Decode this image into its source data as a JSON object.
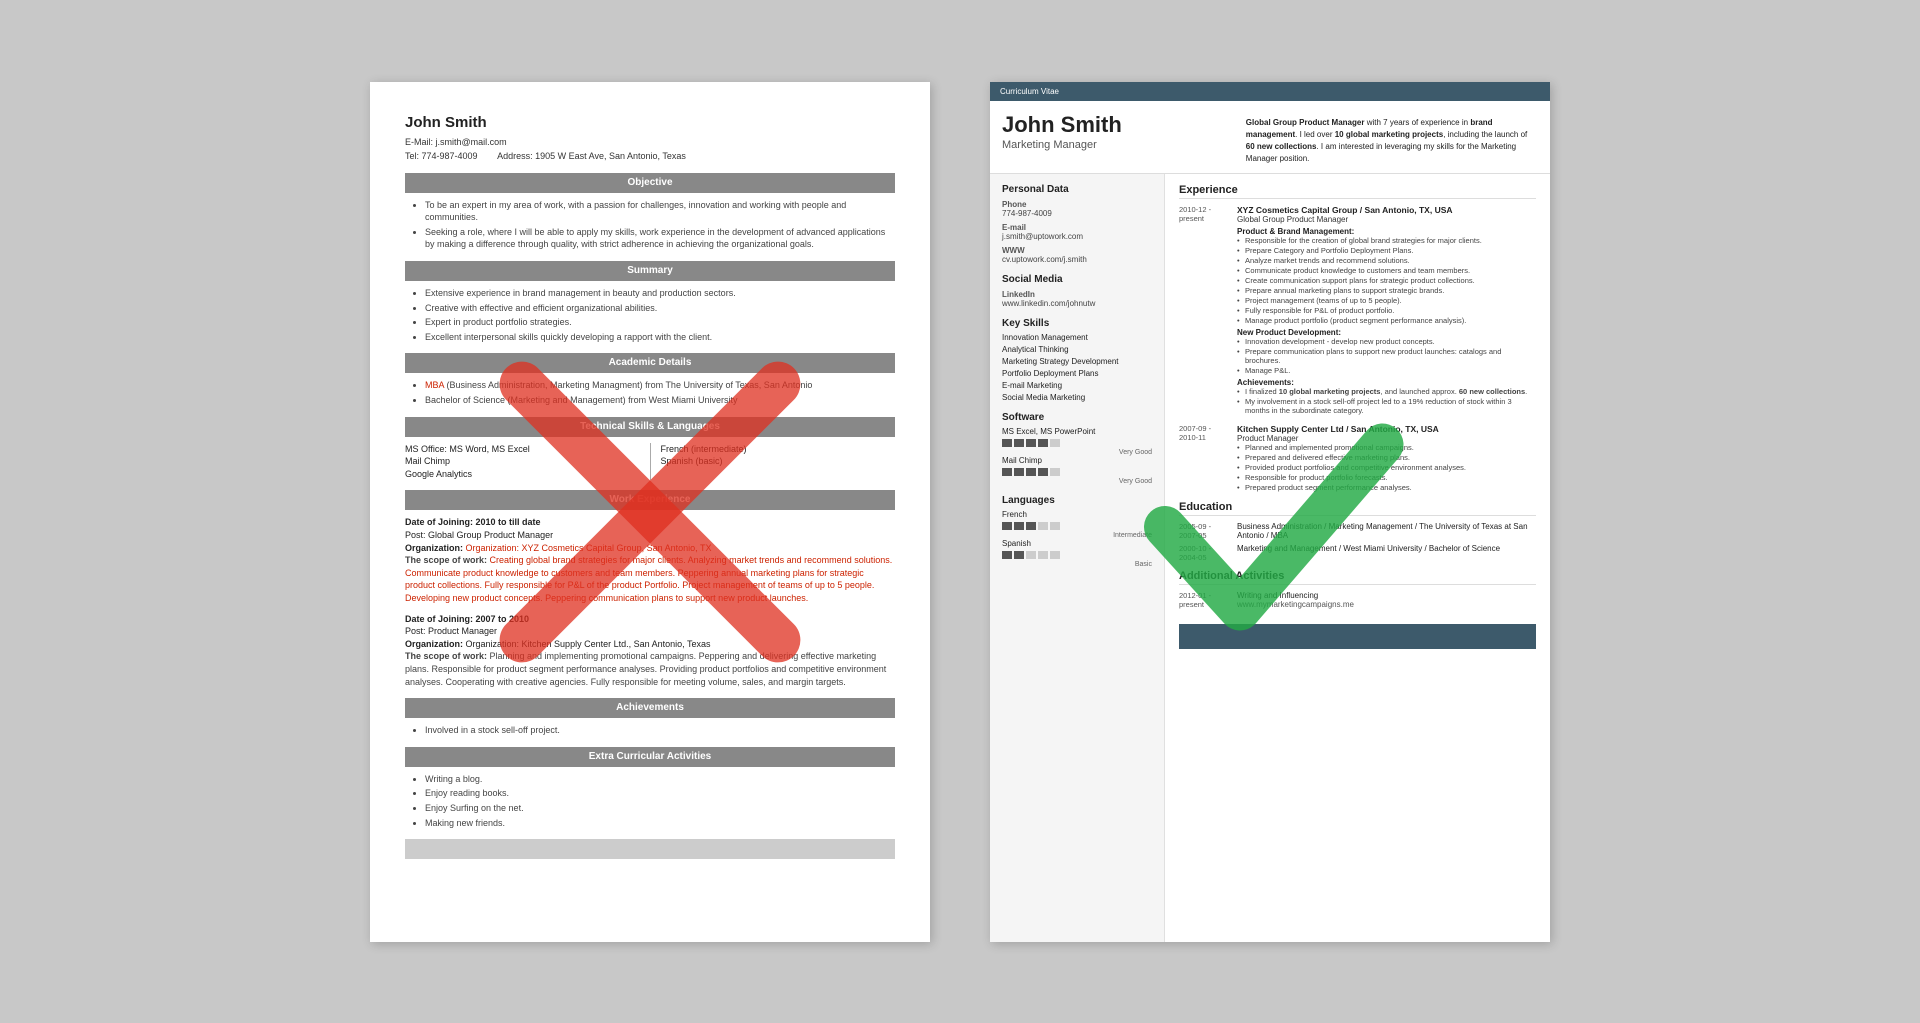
{
  "left_resume": {
    "name": "John Smith",
    "email": "E-Mail: j.smith@mail.com",
    "tel": "Tel: 774-987-4009",
    "address": "Address: 1905 W East Ave, San Antonio, Texas",
    "sections": {
      "objective": {
        "title": "Objective",
        "bullets": [
          "To be an expert in my area of work, with a passion for challenges, innovation and working with people and communities.",
          "Seeking a role, where I will be able to apply my skills, work experience in the development of advanced applications by making a difference through quality, with strict adherence in achieving the organizational goals."
        ]
      },
      "summary": {
        "title": "Summary",
        "bullets": [
          "Extensive experience in brand management in beauty and production sectors.",
          "Creative with effective and efficient organizational abilities.",
          "Expert in product portfolio strategies.",
          "Excellent interpersonal skills quickly developing a rapport with the client."
        ]
      },
      "academic": {
        "title": "Academic Details",
        "bullets": [
          "MBA (Business Administration, Marketing Managment) from The University of Texas, San Antonio",
          "Bachelor of Science (Marketing and Management) from West Miami University"
        ]
      },
      "technical": {
        "title": "Technical Skills & Languages",
        "col1": [
          "MS Office: MS Word, MS Excel",
          "Mail Chimp",
          "Google Analytics"
        ],
        "col2": [
          "French (intermediate)",
          "Spanish (basic)"
        ]
      },
      "work": {
        "title": "Work Experience",
        "entries": [
          {
            "date_of_joining": "Date of Joining: 2010 to till date",
            "post": "Post: Global Group Product Manager",
            "org": "Organization: XYZ Cosmetics Capital Group, San Antonio, TX",
            "scope_label": "The scope of work:",
            "scope": "Creating global brand strategies for major clients. Analyzing market trends and recommend solutions. Communicate product knowledge to customers and team members. Peppering annual marketing plans for strategic product collections. Fully responsible for P&L of the product Portfolio. Project management of teams of up to 5 people. Developing new product concepts. Peppering communication plans to support new product launches."
          },
          {
            "date_of_joining": "Date of Joining: 2007 to 2010",
            "post": "Post: Product Manager",
            "org": "Organization: Kitchen Supply Center Ltd., San Antonio, Texas",
            "scope_label": "The scope of work:",
            "scope": "Planning and implementing promotional campaigns. Peppering and delivering effective marketing plans. Responsible for product segment performance analyses. Providing product portfolios and competitive environment analyses. Cooperating with creative agencies. Fully responsible for meeting volume, sales, and margin targets."
          }
        ]
      },
      "achievements": {
        "title": "Achievements",
        "bullets": [
          "Involved in a stock sell-off project."
        ]
      },
      "extra": {
        "title": "Extra Curricular Activities",
        "bullets": [
          "Writing a blog.",
          "Enjoy reading books.",
          "Enjoy Surfing on the net.",
          "Making new friends."
        ]
      }
    }
  },
  "right_resume": {
    "cv_label": "Curriculum Vitae",
    "name": "John Smith",
    "title": "Marketing Manager",
    "summary": "Global Group Product Manager with 7 years of experience in brand management. I led over 10 global marketing projects, including the launch of 60 new collections. I am interested in leveraging my skills for the Marketing Manager position.",
    "sidebar": {
      "personal_data": {
        "title": "Personal Data",
        "phone_label": "Phone",
        "phone": "774-987-4009",
        "email_label": "E-mail",
        "email": "j.smith@uptowork.com",
        "www_label": "WWW",
        "www": "cv.uptowork.com/j.smith"
      },
      "social_media": {
        "title": "Social Media",
        "linkedin_label": "LinkedIn",
        "linkedin": "www.linkedin.com/johnutw"
      },
      "key_skills": {
        "title": "Key Skills",
        "items": [
          "Innovation Management",
          "Analytical Thinking",
          "Marketing Strategy Development",
          "Portfolio Deployment Plans",
          "E-mail Marketing",
          "Social Media Marketing"
        ]
      },
      "software": {
        "title": "Software",
        "items": [
          {
            "name": "MS Excel, MS PowerPoint",
            "bars": 4,
            "total": 5,
            "label": "Very Good"
          },
          {
            "name": "Mail Chimp",
            "bars": 4,
            "total": 5,
            "label": "Very Good"
          }
        ]
      },
      "languages": {
        "title": "Languages",
        "items": [
          {
            "name": "French",
            "bars": 3,
            "total": 5,
            "label": "Intermediate"
          },
          {
            "name": "Spanish",
            "bars": 2,
            "total": 5,
            "label": "Basic"
          }
        ]
      }
    },
    "main": {
      "experience": {
        "title": "Experience",
        "entries": [
          {
            "date_start": "2010-12 -",
            "date_end": "present",
            "company": "XYZ Cosmetics Capital Group / San Antonio, TX, USA",
            "role": "Global Group Product Manager",
            "section1": "Product & Brand Management:",
            "bullets1": [
              "Responsible for the creation of global brand strategies for major clients.",
              "Prepare Category and Portfolio Deployment Plans.",
              "Analyze market trends and recommend solutions.",
              "Communicate product knowledge to customers and team members.",
              "Create communication support plans for strategic product collections.",
              "Prepare annual marketing plans to support strategic brands.",
              "Project management (teams of up to 5 people).",
              "Fully responsible for P&L of product portfolio.",
              "Manage product portfolio (product segment performance analysis)."
            ],
            "section2": "New Product Development:",
            "bullets2": [
              "Innovation development - develop new product concepts.",
              "Prepare communication plans to support new product launches: catalogs and brochures.",
              "Manage P&L."
            ],
            "section3": "Achievements:",
            "bullets3": [
              "I finalized 10 global marketing projects, and launched approx. 60 new collections.",
              "My involvement in a stock sell-off project led to a 19% reduction of stock within 3 months in the subordinate category."
            ]
          },
          {
            "date_start": "2007-09 -",
            "date_end": "2010-11",
            "company": "Kitchen Supply Center Ltd / San Antonio, TX, USA",
            "role": "Product Manager",
            "section1": "",
            "bullets1": [
              "Planned and implemented promotional campaigns.",
              "Prepared and delivered effective marketing plans.",
              "Provided product portfolios and competitive environment analyses.",
              "Responsible for product portfolio forecasts.",
              "Prepared product segment performance analyses."
            ],
            "section2": "",
            "bullets2": [],
            "section3": "",
            "bullets3": []
          }
        ]
      },
      "education": {
        "title": "Education",
        "entries": [
          {
            "date_start": "2005-09 -",
            "date_end": "2007-05",
            "details": "Business Administration / Marketing Management / The University of Texas at San Antonio / MBA"
          },
          {
            "date_start": "2000-10 -",
            "date_end": "2004-05",
            "details": "Marketing and Management / West Miami University / Bachelor of Science"
          }
        ]
      },
      "additional": {
        "title": "Additional Activities",
        "entries": [
          {
            "date_start": "2012-01 -",
            "date_end": "present",
            "details": "Writing and Influencing",
            "sub": "www.mymarketingcampaigns.me"
          }
        ]
      }
    }
  }
}
